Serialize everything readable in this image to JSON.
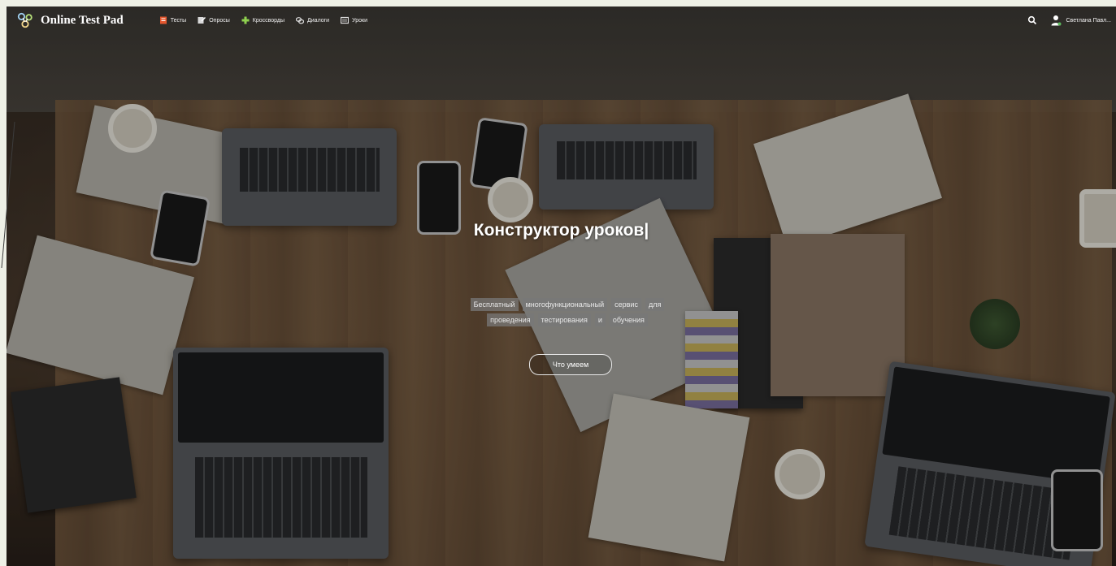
{
  "navbar": {
    "brand": "Online Test Pad",
    "items": [
      {
        "label": "Тесты",
        "icon": "test-icon"
      },
      {
        "label": "Опросы",
        "icon": "poll-icon"
      },
      {
        "label": "Кроссворды",
        "icon": "crossword-icon"
      },
      {
        "label": "Диалоги",
        "icon": "dialog-icon"
      },
      {
        "label": "Уроки",
        "icon": "lesson-icon"
      }
    ],
    "user_name": "Светлана Павл..."
  },
  "hero": {
    "title": "Конструктор уроков|",
    "tags": [
      "Бесплатный",
      "многофункциональный",
      "сервис",
      "для",
      "проведения",
      "тестирования",
      "и",
      "обучения"
    ],
    "cta_label": "Что умеем"
  },
  "colors": {
    "overlay_text": "#ffffff",
    "tag_bg": "#787878"
  }
}
